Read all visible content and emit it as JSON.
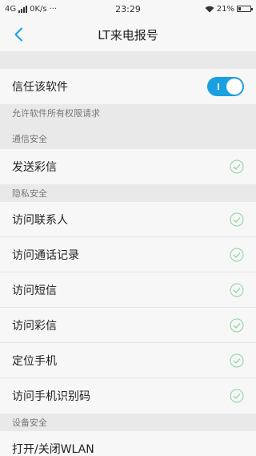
{
  "status_bar": {
    "network": "4G",
    "speed": "0K/s",
    "dots": "···",
    "time": "23:29",
    "battery": "21%",
    "battery_level": 0.21
  },
  "header": {
    "title": "LT来电报号"
  },
  "trust": {
    "label": "信任该软件",
    "enabled": true,
    "hint": "允许软件所有权限请求"
  },
  "sections": [
    {
      "title": "通信安全",
      "items": [
        {
          "label": "发送彩信",
          "granted": true
        }
      ]
    },
    {
      "title": "隐私安全",
      "items": [
        {
          "label": "访问联系人",
          "granted": true
        },
        {
          "label": "访问通话记录",
          "granted": true
        },
        {
          "label": "访问短信",
          "granted": true
        },
        {
          "label": "访问彩信",
          "granted": true
        },
        {
          "label": "定位手机",
          "granted": true
        },
        {
          "label": "访问手机识别码",
          "granted": true
        }
      ]
    },
    {
      "title": "设备安全",
      "items": [
        {
          "label": "打开/关闭WLAN",
          "granted": true
        }
      ]
    }
  ],
  "colors": {
    "accent": "#1a9fe0",
    "check": "#8fd19a"
  }
}
